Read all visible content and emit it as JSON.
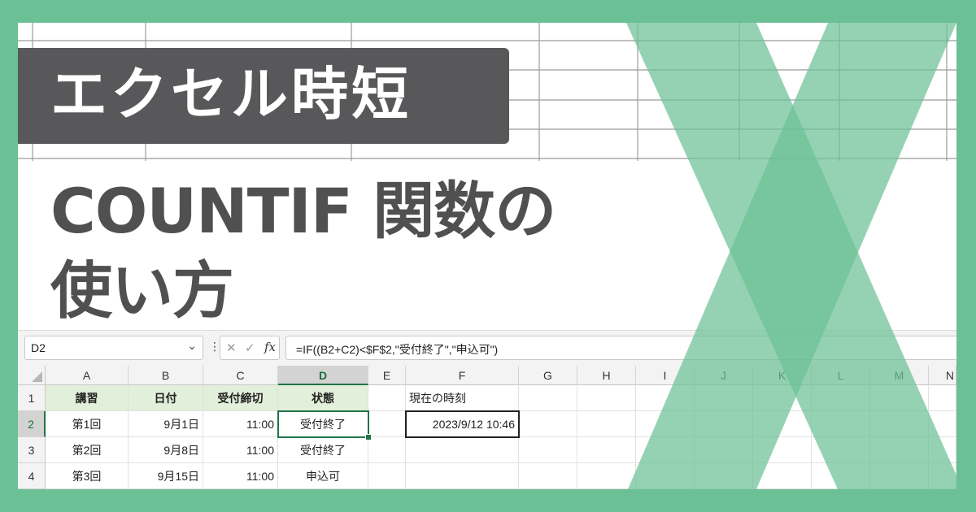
{
  "banner": {
    "title": "エクセル時短"
  },
  "headline": {
    "line1": "COUNTIF 関数の",
    "line2": "使い方"
  },
  "formula_bar": {
    "name_box": "D2",
    "formula": "=IF((B2+C2)<$F$2,\"受付終了\",\"申込可\")",
    "fx_label": "fx",
    "cancel_glyph": "✕",
    "enter_glyph": "✓",
    "more_glyph": "⋮",
    "dropdown_glyph": "⌄"
  },
  "sheet": {
    "columns": [
      "A",
      "B",
      "C",
      "D",
      "E",
      "F",
      "G",
      "H",
      "I",
      "J",
      "K",
      "L",
      "M",
      "N"
    ],
    "rows": [
      "1",
      "2",
      "3",
      "4"
    ],
    "header_row": [
      "講習",
      "日付",
      "受付締切",
      "状態"
    ],
    "data_rows": [
      [
        "第1回",
        "9月1日",
        "11:00",
        "受付終了"
      ],
      [
        "第2回",
        "9月8日",
        "11:00",
        "受付終了"
      ],
      [
        "第3回",
        "9月15日",
        "11:00",
        "申込可"
      ]
    ],
    "now_label": "現在の時刻",
    "now_value": "2023/9/12 10:46",
    "active_cell": "D2"
  },
  "colors": {
    "frame_green": "#6cc095",
    "banner_gray": "#58575a",
    "headline_gray": "#505050",
    "header_fill": "#e2efda",
    "excel_green": "#217346"
  },
  "icons": [
    "excel-x-logo-icon",
    "close-icon",
    "check-icon",
    "function-icon",
    "chevron-down-icon",
    "more-vertical-icon",
    "select-all-icon"
  ]
}
